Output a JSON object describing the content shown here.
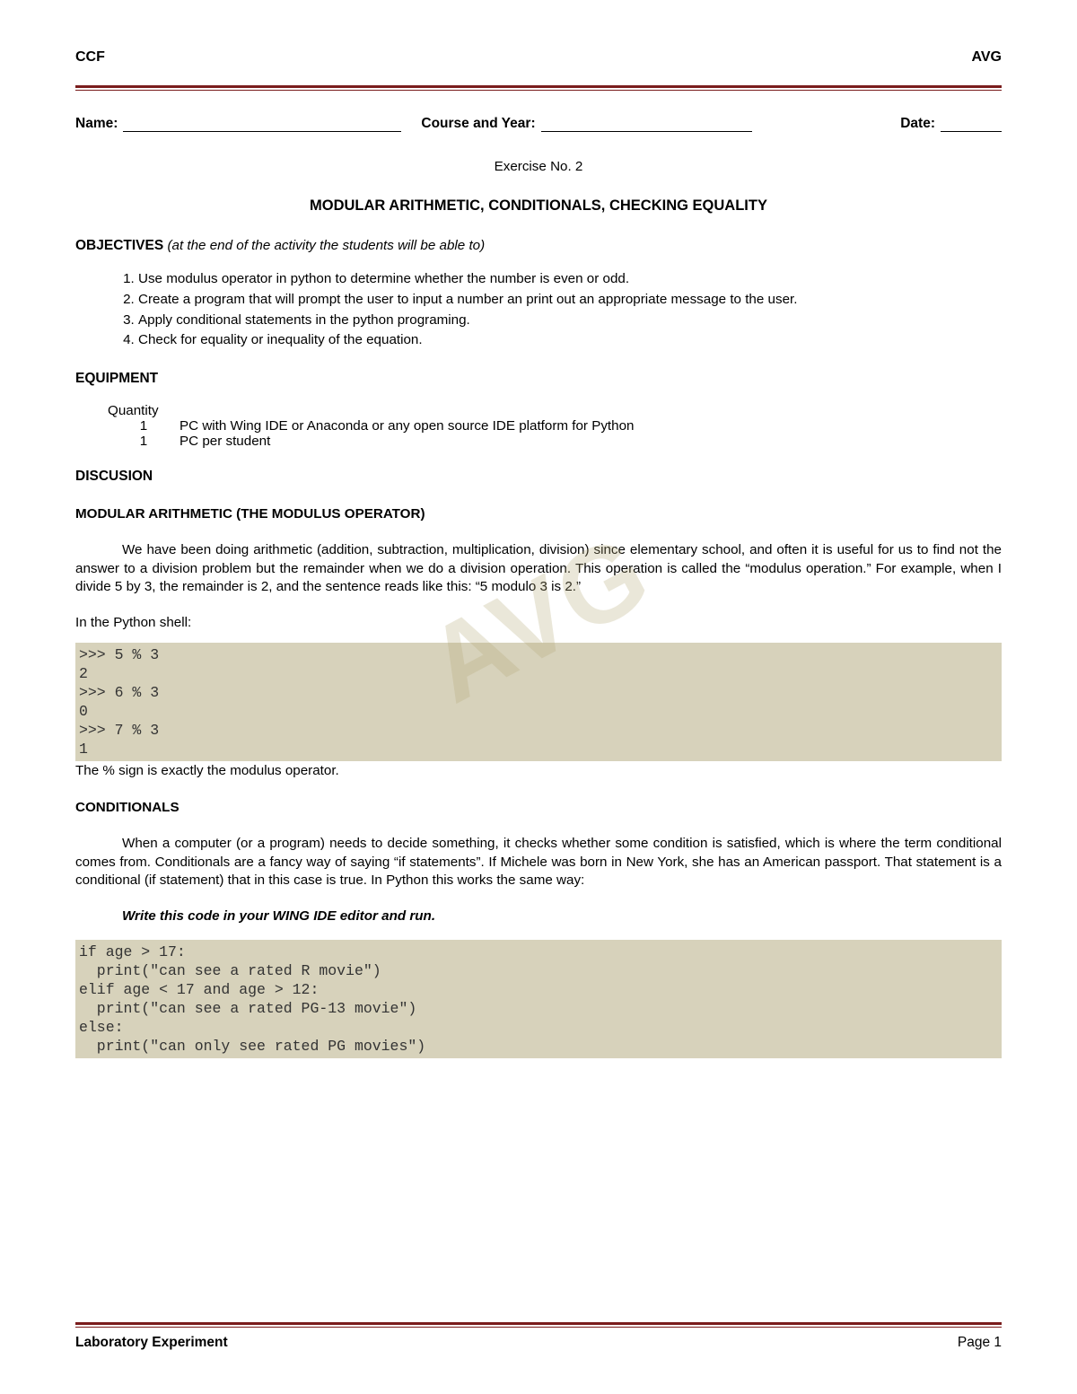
{
  "header": {
    "left": "CCF",
    "right": "AVG"
  },
  "watermark": "AVG",
  "form": {
    "name_label": "Name:",
    "course_label": "Course and Year:",
    "date_label": "Date:"
  },
  "exercise_no": "Exercise No. 2",
  "title": "MODULAR ARITHMETIC, CONDITIONALS, CHECKING EQUALITY",
  "objectives": {
    "heading": "OBJECTIVES",
    "note": "(at the end of the activity the students will be able to)",
    "items": [
      "Use modulus operator in python to determine whether the number is even or odd.",
      "Create a program that will prompt the user to input a number an print out an appropriate message to the user.",
      "Apply conditional statements in the python programing.",
      "Check for equality or inequality of the equation."
    ]
  },
  "equipment": {
    "heading": "EQUIPMENT",
    "qty_label": "Quantity",
    "rows": [
      {
        "qty": "1",
        "desc": "PC with Wing IDE or Anaconda or any open source IDE platform for Python"
      },
      {
        "qty": "1",
        "desc": "PC per student"
      }
    ]
  },
  "discussion_heading": "DISCUSION",
  "modular": {
    "heading": "MODULAR ARITHMETIC (THE MODULUS OPERATOR)",
    "para": "We have been doing arithmetic (addition, subtraction, multiplication, division) since elementary school, and often it is useful for us to find not the answer to a division problem but the remainder when we do a division operation. This operation is called the “modulus operation.” For example, when I divide 5 by 3, the remainder is 2, and the sentence reads like this: “5 modulo 3 is 2.”",
    "shell_label": "In the Python shell:",
    "code": ">>> 5 % 3\n2\n>>> 6 % 3\n0\n>>> 7 % 3\n1",
    "after": "The % sign is exactly the modulus operator."
  },
  "conditionals": {
    "heading": "CONDITIONALS",
    "para": "When a computer (or a program) needs to decide something, it checks whether some condition is satisfied, which is where the term conditional comes from. Conditionals are a fancy way of saying “if statements”. If Michele was born in New York, she has an American passport. That statement is a conditional (if statement) that in this case is true. In Python this works the same way:",
    "instruction": "Write this code in your WING IDE editor and run.",
    "code": "if age > 17:\n  print(\"can see a rated R movie\")\nelif age < 17 and age > 12:\n  print(\"can see a rated PG-13 movie\")\nelse:\n  print(\"can only see rated PG movies\")"
  },
  "footer": {
    "left": "Laboratory Experiment",
    "right": "Page 1"
  }
}
